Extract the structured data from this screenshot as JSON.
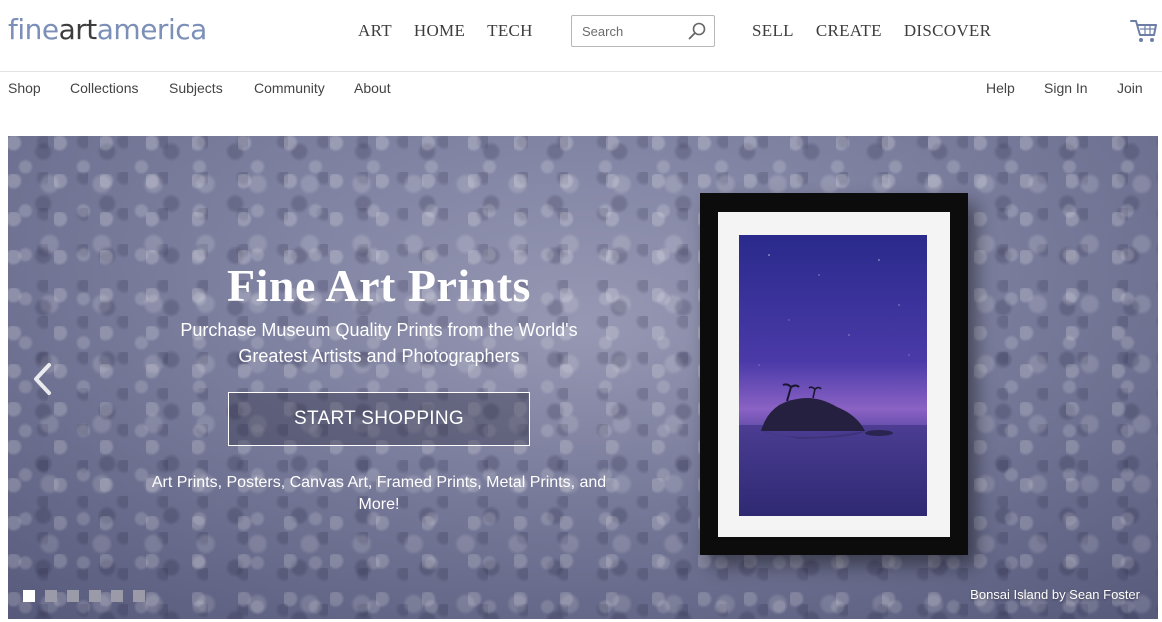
{
  "header": {
    "logo": {
      "part1": "fine",
      "part2": "art",
      "part3": "america"
    },
    "nav_left": [
      "ART",
      "HOME",
      "TECH"
    ],
    "nav_right": [
      "SELL",
      "CREATE",
      "DISCOVER"
    ],
    "search": {
      "placeholder": "Search"
    }
  },
  "subnav": {
    "left": [
      "Shop",
      "Collections",
      "Subjects",
      "Community",
      "About"
    ],
    "right": [
      "Help",
      "Sign In",
      "Join"
    ]
  },
  "hero": {
    "title": "Fine Art Prints",
    "subtitle_line1": "Purchase Museum Quality Prints from the World's",
    "subtitle_line2": "Greatest Artists and Photographers",
    "cta": "START SHOPPING",
    "note_line1": "Art Prints, Posters, Canvas Art, Framed Prints, Metal Prints, and",
    "note_line2": "More!",
    "caption": "Bonsai Island by Sean Foster",
    "slide_count": 6,
    "active_slide": 1
  },
  "colors": {
    "logo_accent": "#7b8fb8",
    "nav_text": "#3d3d3d",
    "hero_bg": "#7d80a0",
    "cta_border": "#ffffff"
  },
  "icons": {
    "search": "search-icon",
    "cart": "cart-icon",
    "prev": "chevron-left-icon"
  }
}
